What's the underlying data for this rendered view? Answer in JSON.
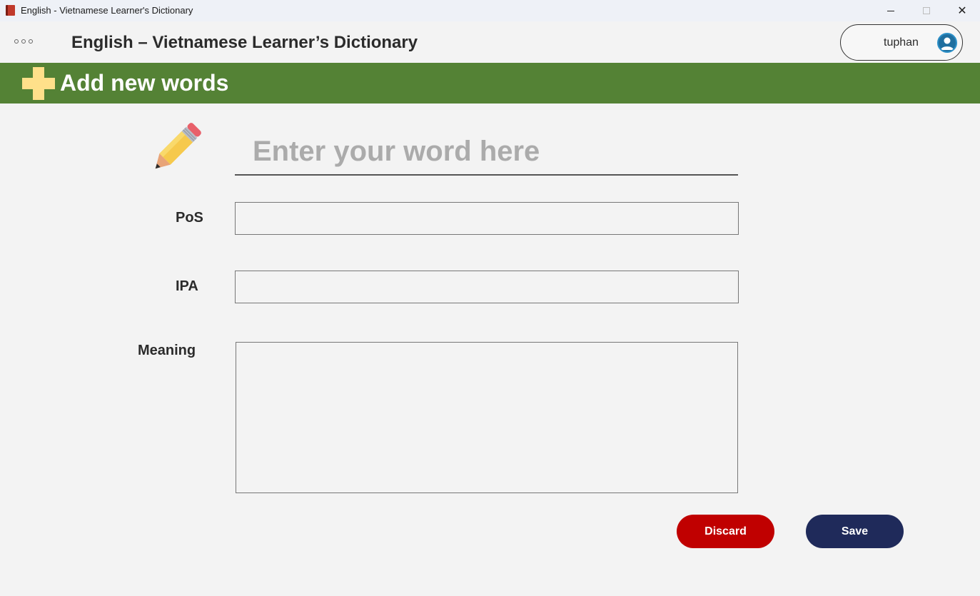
{
  "window": {
    "title": "English - Vietnamese Learner's Dictionary",
    "icon": "book-icon"
  },
  "header": {
    "app_title": "English – Vietnamese Learner’s Dictionary",
    "menu_icon": "more-dots-icon",
    "user": {
      "name": "tuphan",
      "icon": "user-avatar-icon"
    }
  },
  "banner": {
    "title": "Add new words",
    "icon": "plus-icon",
    "color": "#548235"
  },
  "form": {
    "word_icon": "pencil-icon",
    "word_input": {
      "placeholder": "Enter your word here",
      "value": ""
    },
    "pos": {
      "label": "PoS",
      "value": ""
    },
    "ipa": {
      "label": "IPA",
      "value": ""
    },
    "meaning": {
      "label": "Meaning",
      "value": ""
    }
  },
  "actions": {
    "discard_label": "Discard",
    "discard_color": "#c00000",
    "save_label": "Save",
    "save_color": "#1f2a5a"
  }
}
